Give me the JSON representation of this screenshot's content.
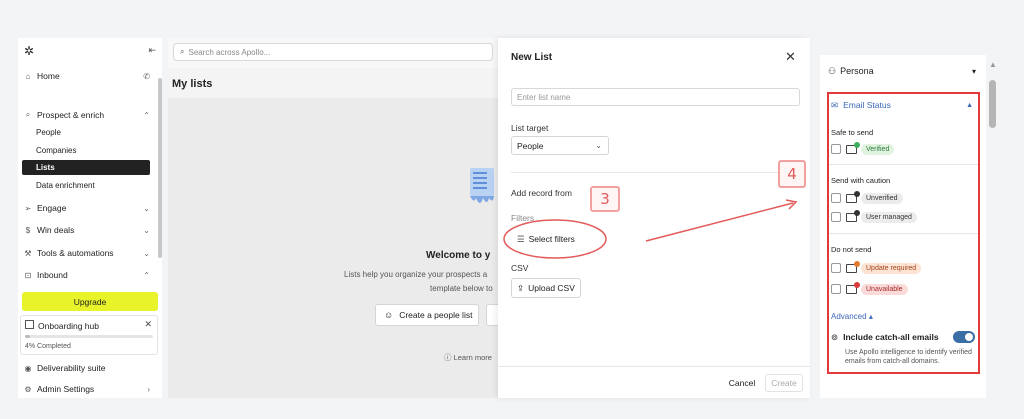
{
  "sidebar": {
    "home": "Home",
    "prospect": "Prospect & enrich",
    "people": "People",
    "companies": "Companies",
    "lists": "Lists",
    "data_enrichment": "Data enrichment",
    "engage": "Engage",
    "win_deals": "Win deals",
    "tools": "Tools & automations",
    "inbound": "Inbound",
    "upgrade": "Upgrade",
    "onboarding_hub": "Onboarding hub",
    "onboarding_progress": "4% Completed",
    "onboarding_fraction": 0.04,
    "deliverability": "Deliverability suite",
    "admin": "Admin Settings"
  },
  "search": {
    "placeholder": "Search across Apollo..."
  },
  "main": {
    "title": "My lists",
    "welcome": "Welcome to y",
    "desc_line1": "Lists help you organize your prospects a",
    "desc_line2": "template below to",
    "create_people_list": "Create a people list",
    "learn_more": "Learn more"
  },
  "modal": {
    "title": "New List",
    "name_placeholder": "Enter list name",
    "target_label": "List target",
    "target_value": "People",
    "add_record_label": "Add record from",
    "filters_label": "Filters",
    "select_filters": "Select filters",
    "csv_label": "CSV",
    "upload_csv": "Upload CSV",
    "cancel": "Cancel",
    "create": "Create"
  },
  "annotations": {
    "step3": "3",
    "step4": "4"
  },
  "panel": {
    "persona": "Persona",
    "email_status": "Email Status",
    "safe_to_send": "Safe to send",
    "verified": "Verified",
    "send_with_caution": "Send with caution",
    "unverified": "Unverified",
    "user_managed": "User managed",
    "do_not_send": "Do not send",
    "update_required": "Update required",
    "unavailable": "Unavailable",
    "advanced": "Advanced",
    "catch_all": "Include catch-all emails",
    "catch_all_desc": "Use Apollo intelligence to identify verified emails from catch-all domains."
  },
  "colors": {
    "accent_red": "#e03a3a",
    "link_blue": "#3a68b8",
    "upgrade_yellow": "#e8f32a",
    "verified_green": "#dff3df",
    "warning_orange": "#fde3d4"
  }
}
